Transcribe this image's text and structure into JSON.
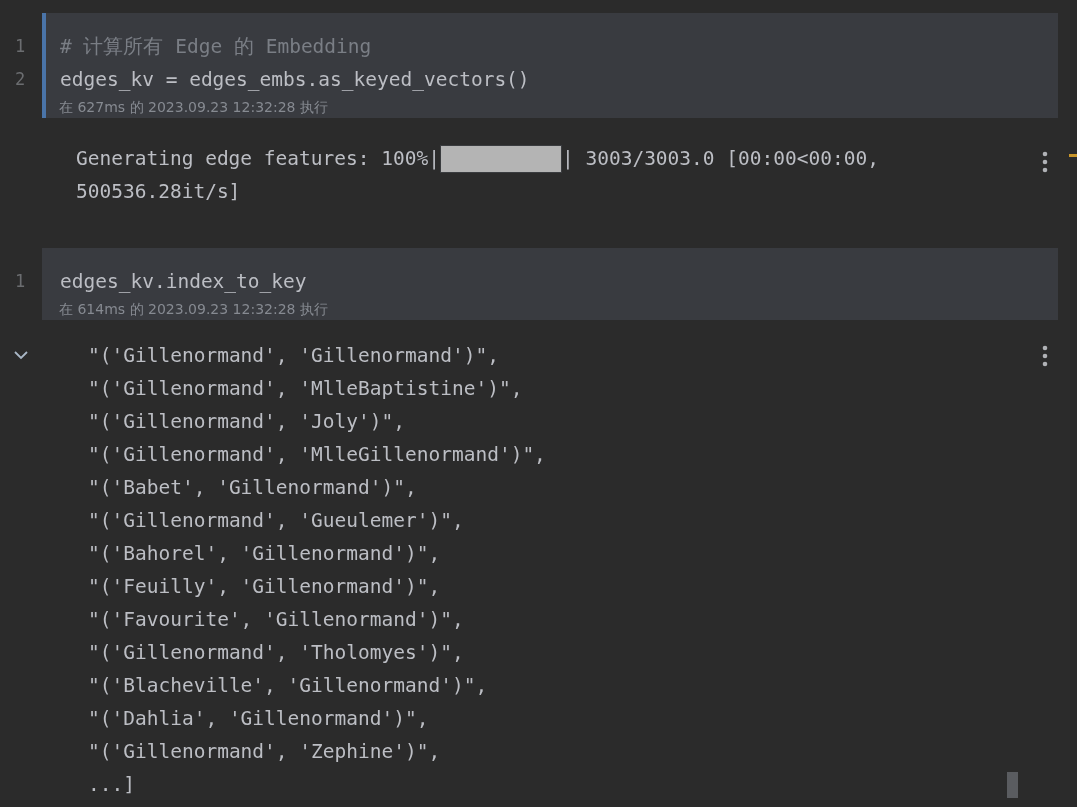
{
  "cells": [
    {
      "selected": true,
      "lines": [
        {
          "number": "1",
          "kind": "comment",
          "text": "# 计算所有 Edge 的 Embedding"
        },
        {
          "number": "2",
          "kind": "code",
          "text": "edges_kv = edges_embs.as_keyed_vectors()"
        }
      ],
      "status": "在 627ms 的 2023.09.23 12:32:28 执行",
      "output": {
        "kind": "progress",
        "prefix": "Generating edge features: 100%|",
        "level": 1,
        "suffix": "| 3003/3003.0 [00:00<00:00,",
        "continuation": "500536.28it/s]"
      }
    },
    {
      "selected": false,
      "lines": [
        {
          "number": "1",
          "kind": "code",
          "text": "edges_kv.index_to_key"
        }
      ],
      "status": "在 614ms 的 2023.09.23 12:32:28 执行",
      "output": {
        "kind": "list",
        "expanded": true,
        "items": [
          "\"('Gillenormand', 'Gillenormand')\",",
          "\"('Gillenormand', 'MlleBaptistine')\",",
          "\"('Gillenormand', 'Joly')\",",
          "\"('Gillenormand', 'MlleGillenormand')\",",
          "\"('Babet', 'Gillenormand')\",",
          "\"('Gillenormand', 'Gueulemer')\",",
          "\"('Bahorel', 'Gillenormand')\",",
          "\"('Feuilly', 'Gillenormand')\",",
          "\"('Favourite', 'Gillenormand')\",",
          "\"('Gillenormand', 'Tholomyes')\",",
          "\"('Blacheville', 'Gillenormand')\",",
          "\"('Dahlia', 'Gillenormand')\",",
          "\"('Gillenormand', 'Zephine')\",",
          "...]"
        ]
      }
    }
  ]
}
